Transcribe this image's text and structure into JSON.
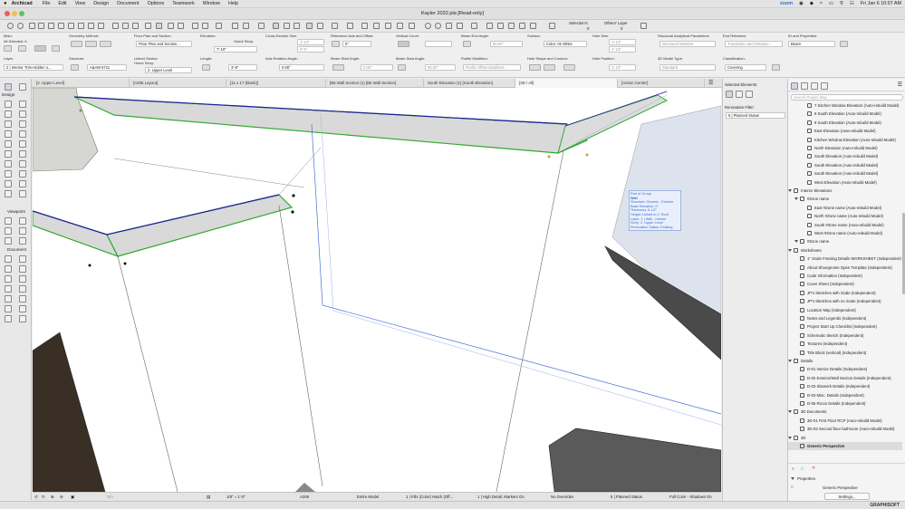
{
  "menubar": {
    "app_name": "Archicad",
    "items": [
      "File",
      "Edit",
      "View",
      "Design",
      "Document",
      "Options",
      "Teamwork",
      "Window",
      "Help"
    ],
    "clock": "Fri Jan 6  10:07 AM",
    "zoom_label": "zoom"
  },
  "window": {
    "title": "Kayler 2022.pla [Read-only]",
    "selections_label": "Selection's",
    "selections_count": "0",
    "others_layer_label": "Others' Layer",
    "others_layer_count": "0"
  },
  "infobox": {
    "main_label": "Main:",
    "all_selected": "All Selected: 6",
    "geometry_method_label": "Geometry Method:",
    "floor_plan_label": "Floor Plan and Section:",
    "floor_plan_value": "Floor Plan and Section...",
    "elevation_label": "Elevation:",
    "home_story_label": "Home Story:",
    "elevation_value": "7'-10\"",
    "cross_section_label": "Cross-Section Size:",
    "cs_value_1": "1'-10\"",
    "cs_value_2": "0'-9\"",
    "ref_axis_label": "Reference Axis and Offset:",
    "ref_axis_value": "0\"",
    "vertical_curve_label": "Vertical Curve:",
    "beam_end_angle_label": "Beam End Angle:",
    "beam_end_angle_value": "90.00°",
    "surface_label": "Surface:",
    "surface_value": "Color: 02 White",
    "hole_size_label": "Hole Size:",
    "hole_size_1": "1'-10\"",
    "hole_size_2": "1'-10\"",
    "structural_params_label": "Structural Analytical Parameters",
    "structural_member": "Structural Member",
    "end_releases_label": "End Releases:",
    "end_releases_value": "Translation and Rotation...",
    "id_props_label": "ID and Properties:",
    "id_value": "Beam",
    "layer_label": "Layer:",
    "layer_value": "2 | Interior Trim.Hidden o...",
    "structure_label": "Structure:",
    "structure_value": "A&AM 5711",
    "linked_stories_label": "Linked Stories:",
    "linked_home_story": "Home Story:",
    "linked_story_value": "2. Upper Level",
    "length_label": "Length:",
    "length_value": "3'-9\"",
    "axis_rotation_label": "Axis Rotation Angle:",
    "axis_rotation_value": "0.00°",
    "beam_start_angle_label": "Beam Start Angle:",
    "beam_start_value": "0.00\"",
    "beam_start_angle2_label": "Beam Start Angle:",
    "beam_start_angle2_value": "90.00°",
    "profile_modifiers_label": "Profile Modifiers:",
    "profile_modifiers_value": "Profile Offset Modifiers...",
    "hole_shape_label": "Hole Shape and Contour:",
    "hole_position_label": "Hole Position:",
    "hole_position_value": "1'-10\"",
    "model_type_label": "3D Model Type:",
    "model_type_value": "Standard",
    "classification_label": "Classification:",
    "classification_value": "Covering"
  },
  "tabs": [
    {
      "label": "[2. Upper Level]"
    },
    {
      "label": "[A206 Layout]"
    },
    {
      "label": "[11 x 17 (blank)]"
    },
    {
      "label": "[B5 Wall Section (1) [B5 Wall Section]"
    },
    {
      "label": "South Elevation (1) [South Elevation]"
    },
    {
      "label": "[3D / All]"
    },
    {
      "label": "[Action Center]"
    }
  ],
  "toolbox": {
    "select_label": "Design",
    "viewpoint_label": "Viewpoint",
    "document_label": "Document"
  },
  "tooltip": {
    "lines": [
      "Part of Group",
      "Wall",
      "Structure: Generic - Exterior",
      "Base Elevation: 0\"",
      "Thickness: 6 1/2\"",
      "Height: Linked to 2. Roof",
      "Layer: 1 | Wall - Interior",
      "Story: 2. Upper Level",
      "Renovation Status: Existing"
    ]
  },
  "selection_panel": {
    "selected_elements_label": "Selected Elements:",
    "renovation_filter_label": "Renovation Filter:",
    "renovation_filter_value": "5 | Planned Status"
  },
  "navigator": {
    "search_placeholder": "Search Project Map",
    "items": [
      {
        "label": "7 Kitchen Window Elevation (Auto-rebuild Model)",
        "depth": 2,
        "kind": "item"
      },
      {
        "label": "8 South Elevation (Auto-rebuild Model)",
        "depth": 2,
        "kind": "item"
      },
      {
        "label": "9 South Elevation (Auto-rebuild Model)",
        "depth": 2,
        "kind": "item"
      },
      {
        "label": "East Elevation (Auto-rebuild Model)",
        "depth": 2,
        "kind": "item"
      },
      {
        "label": "Kitchen Window Elevation (Auto-rebuild Model)",
        "depth": 2,
        "kind": "item"
      },
      {
        "label": "North Elevation (Auto-rebuild Model)",
        "depth": 2,
        "kind": "item"
      },
      {
        "label": "South Elevation (Auto-rebuild Model)",
        "depth": 2,
        "kind": "item"
      },
      {
        "label": "South Elevation (Auto-rebuild Model)",
        "depth": 2,
        "kind": "item"
      },
      {
        "label": "South Elevation (Auto-rebuild Model)",
        "depth": 2,
        "kind": "item"
      },
      {
        "label": "West Elevation (Auto-rebuild Model)",
        "depth": 2,
        "kind": "item"
      },
      {
        "label": "Interior Elevations",
        "depth": 0,
        "kind": "folder"
      },
      {
        "label": "#Zone name",
        "depth": 1,
        "kind": "folder"
      },
      {
        "label": "East #Zone name (Auto-rebuild Model)",
        "depth": 2,
        "kind": "item"
      },
      {
        "label": "North #Zone name (Auto-rebuild Model)",
        "depth": 2,
        "kind": "item"
      },
      {
        "label": "South #Zone name (Auto-rebuild Model)",
        "depth": 2,
        "kind": "item"
      },
      {
        "label": "West #Zone name (Auto-rebuild Model)",
        "depth": 2,
        "kind": "item"
      },
      {
        "label": "#Zone name",
        "depth": 1,
        "kind": "folder"
      },
      {
        "label": "Worksheets",
        "depth": 0,
        "kind": "folder"
      },
      {
        "label": "1\" Scale Framing Details WORKSHEET (Independent)",
        "depth": 1,
        "kind": "item"
      },
      {
        "label": "About Shoegnome Open Template (Independent)",
        "depth": 1,
        "kind": "item"
      },
      {
        "label": "Code Information (Independent)",
        "depth": 1,
        "kind": "item"
      },
      {
        "label": "Cover Sheet (Independent)",
        "depth": 1,
        "kind": "item"
      },
      {
        "label": "JP's Sketches with Scale (Independent)",
        "depth": 1,
        "kind": "item"
      },
      {
        "label": "JP's Sketches with no Scale (Independent)",
        "depth": 1,
        "kind": "item"
      },
      {
        "label": "Location Map (Independent)",
        "depth": 1,
        "kind": "item"
      },
      {
        "label": "Notes and Legends (Independent)",
        "depth": 1,
        "kind": "item"
      },
      {
        "label": "Project Start Up Checklist (Independent)",
        "depth": 1,
        "kind": "item"
      },
      {
        "label": "Schematic Sketch (Independent)",
        "depth": 1,
        "kind": "item"
      },
      {
        "label": "Textures (Independent)",
        "depth": 1,
        "kind": "item"
      },
      {
        "label": "Title Block (vertical) (Independent)",
        "depth": 1,
        "kind": "item"
      },
      {
        "label": "Details",
        "depth": 0,
        "kind": "folder"
      },
      {
        "label": "D-01 Interior Details (Independent)",
        "depth": 1,
        "kind": "item"
      },
      {
        "label": "D-02 Exterior/Wall Section Details (Independent)",
        "depth": 1,
        "kind": "item"
      },
      {
        "label": "D-03 Sitework Details (Independent)",
        "depth": 1,
        "kind": "item"
      },
      {
        "label": "D-04  Misc. Details (Independent)",
        "depth": 1,
        "kind": "item"
      },
      {
        "label": "D-05 Riccio Details (Independent)",
        "depth": 1,
        "kind": "item"
      },
      {
        "label": "3D Documents",
        "depth": 0,
        "kind": "folder"
      },
      {
        "label": "3D-01 First Floor RCP (Auto-rebuild Model)",
        "depth": 1,
        "kind": "item"
      },
      {
        "label": "3D-02 Second floor bathroom (Auto-rebuild Model)",
        "depth": 1,
        "kind": "item"
      },
      {
        "label": "3D",
        "depth": 0,
        "kind": "folder"
      },
      {
        "label": "Generic Perspective",
        "depth": 1,
        "kind": "selected"
      }
    ],
    "properties_label": "Properties",
    "properties_value": "Generic Perspective",
    "settings_button": "Settings..."
  },
  "statusbar": {
    "zoom_value": "N/A",
    "scale_value": "1/8\"  =  1'-0\"",
    "layout_value": "A206",
    "model_filter": "Entire Model",
    "fill_option": "1 | Fills (Color) Hatch (Off...",
    "detail_level": "1 | High Detail, Markers On",
    "overrides": "No Overrides",
    "renovation": "5 | Planned Status",
    "render_mode": "Full Color - Shadows On"
  },
  "bottom": {
    "graphisoft": "GRAPHISOFT"
  }
}
